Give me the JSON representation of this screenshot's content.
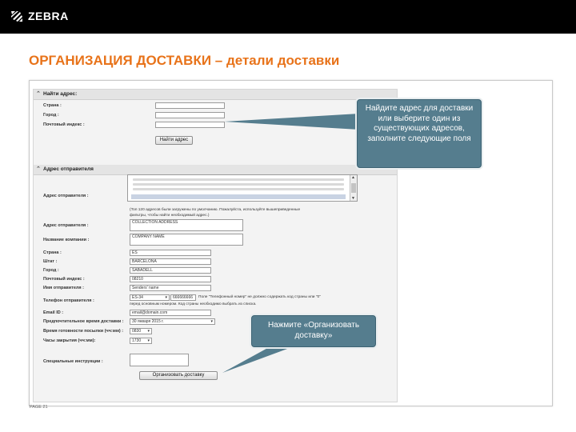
{
  "brand": {
    "name": "ZEBRA",
    "logo_icon": "zebra-head-logo"
  },
  "slide_title": "ОРГАНИЗАЦИЯ ДОСТАВКИ – детали доставки",
  "find_section": {
    "header": "Найти адрес:",
    "country_label": "Страна :",
    "city_label": "Город :",
    "zip_label": "Почтовый индекс :",
    "find_button": "Найти адрес"
  },
  "sender_section": {
    "header": "Адрес отправителя",
    "sender_address_label": "Адрес отправителя :",
    "list_note_line1": "(Топ 120 адресов были загружены по умолчанию. Пожалуйста, используйте вышеприведенные",
    "list_note_line2": "фильтры, чтобы найти необходимый адрес.)",
    "address_label": "Адрес отправителя :",
    "address_value": "COLLECTION ADDRESS",
    "company_label": "Название компании :",
    "company_value": "COMPANY NAME",
    "country_label": "Страна :",
    "country_value": "ES",
    "state_label": "Штат :",
    "state_value": "BARCELONA",
    "city_label": "Город :",
    "city_value": "SABADELL",
    "zip_label": "Почтовый индекс :",
    "zip_value": "08210",
    "sender_name_label": "Имя отправителя :",
    "sender_name_value": "Senders' name",
    "phone_label": "Телефон отправителя :",
    "phone_code": "ES-34",
    "phone_value": "666666666",
    "phone_note_line1": "Поле \"Телефонный номер\" не должно содержать код страны или \"0\"",
    "phone_note_line2": "перед основным номером. Код страны необходимо выбрать из списка.",
    "email_label": "Email ID :",
    "email_value": "email@domain.com",
    "pickup_time_label": "Предпочтительное время доставки :",
    "pickup_time_value": "30 января 2015 г.",
    "ready_time_label": "Время готовности посылки (чч:мм) :",
    "ready_time_value": "0830",
    "close_time_label": "Часы закрытия (чч:мм):",
    "close_time_value": "1730",
    "instructions_label": "Специальные инструкции :",
    "arrange_button": "Организовать доставку"
  },
  "callouts": {
    "find_tip": "Найдите адрес для доставки или выберите один из существующих адресов, заполните следующие поля",
    "arrange_tip": "Нажмите «Организовать доставку»"
  },
  "footer": {
    "page": "PAGE 21"
  },
  "colors": {
    "title": "#e8731a",
    "callout": "#557d8e",
    "topbar": "#000000"
  }
}
